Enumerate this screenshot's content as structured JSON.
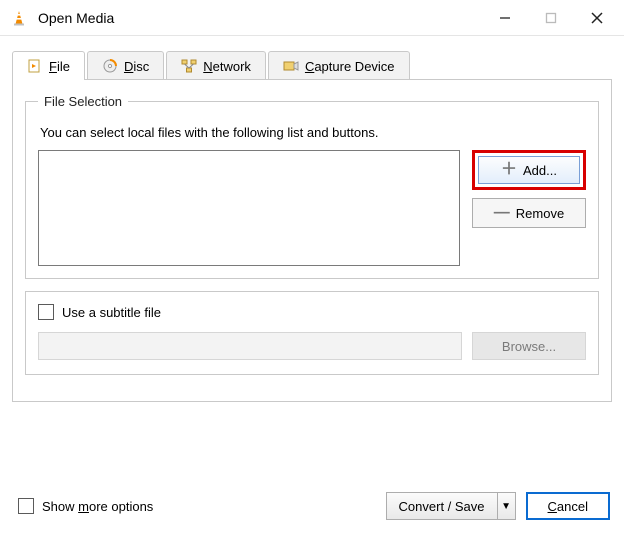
{
  "window": {
    "title": "Open Media"
  },
  "tabs": {
    "file": {
      "prefix": "F",
      "rest": "ile"
    },
    "disc": {
      "prefix": "D",
      "rest": "isc"
    },
    "network": {
      "prefix": "N",
      "rest": "etwork"
    },
    "capture": {
      "prefix": "C",
      "rest": "apture Device"
    }
  },
  "fileSelection": {
    "legend": "File Selection",
    "description": "You can select local files with the following list and buttons.",
    "addLabel": "Add...",
    "removeLabel": "Remove"
  },
  "subtitle": {
    "checkboxLabel": "Use a subtitle file",
    "browseLabel": "Browse..."
  },
  "footer": {
    "showMore_pre": "Show ",
    "showMore_u": "m",
    "showMore_post": "ore options",
    "convertSave": "Convert / Save",
    "cancel_u": "C",
    "cancel_post": "ancel"
  }
}
